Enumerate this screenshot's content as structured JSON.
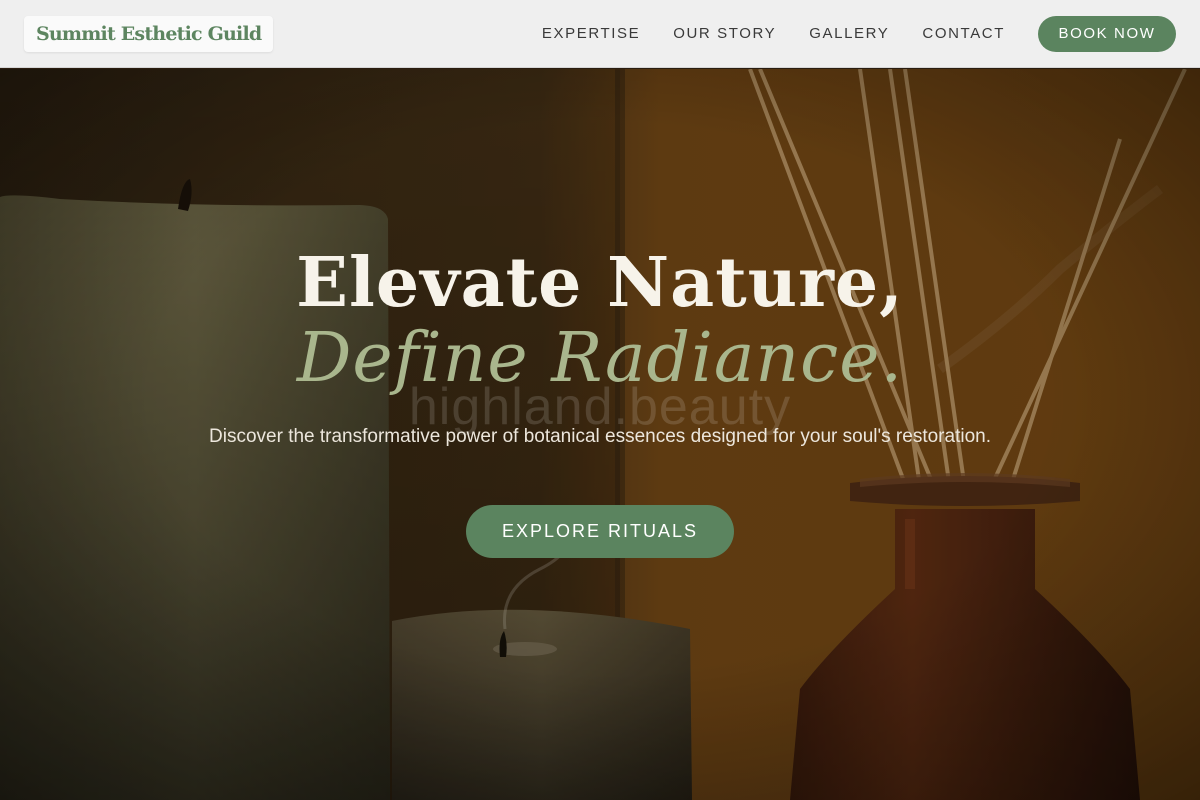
{
  "header": {
    "brand": "Summit Esthetic Guild",
    "nav": [
      {
        "label": "EXPERTISE"
      },
      {
        "label": "OUR STORY"
      },
      {
        "label": "GALLERY"
      },
      {
        "label": "CONTACT"
      }
    ],
    "cta_label": "BOOK NOW"
  },
  "hero": {
    "headline_line1": "Elevate Nature,",
    "headline_line2": "Define Radiance.",
    "watermark": "highland.beauty",
    "subtitle": "Discover the transformative power of botanical essences designed for your soul's restoration.",
    "cta_label": "EXPLORE RITUALS",
    "background_image": "candles-and-reed-diffuser-photo"
  },
  "colors": {
    "accent": "#5b845f",
    "brand_text": "#5d8560",
    "headline_accent": "#a9b68d",
    "header_bg": "#efefef"
  }
}
